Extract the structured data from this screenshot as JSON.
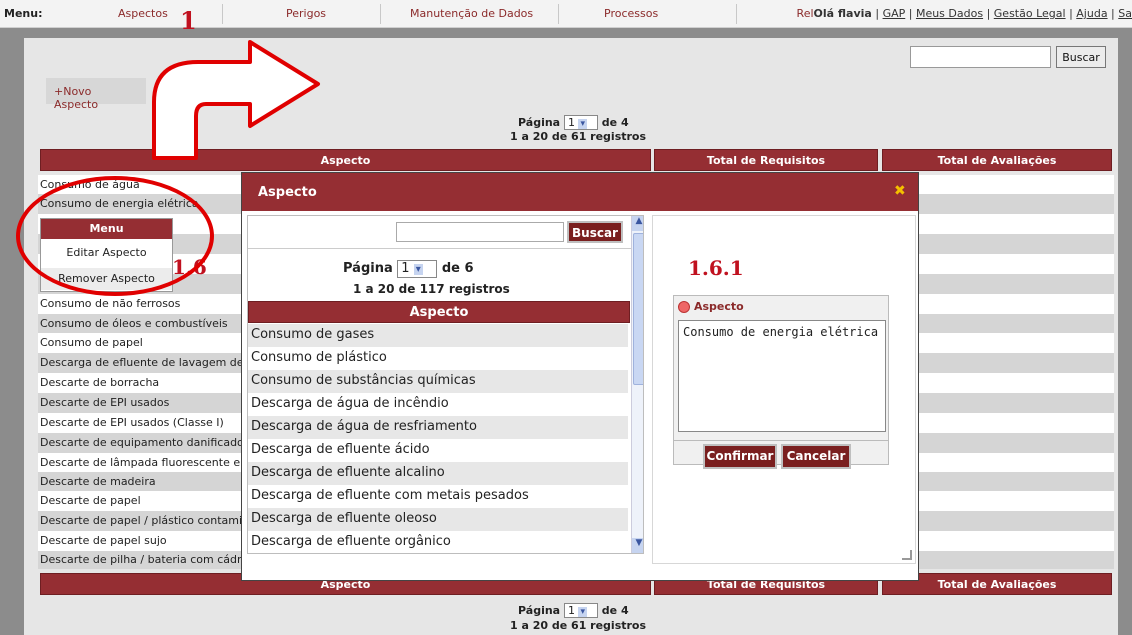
{
  "topbar": {
    "menu_label": "Menu:",
    "items": [
      "Aspectos",
      "Perigos",
      "Manutenção de Dados",
      "Processos"
    ],
    "partial_item": "Rel",
    "user_label": "Olá flavia",
    "links": [
      "GAP",
      "Meus Dados",
      "Gestão Legal",
      "Ajuda",
      "Sa"
    ]
  },
  "search": {
    "button": "Buscar"
  },
  "new_button": "+Novo Aspecto",
  "pagination_top": {
    "label": "Página",
    "value": "1",
    "suffix": "de 4",
    "count": "1 a 20 de 61 registros"
  },
  "table": {
    "headers": [
      "Aspecto",
      "Total de Requisitos",
      "Total de Avaliações"
    ],
    "rows": [
      "Consumo de água",
      "Consumo de energia elétrica",
      "",
      "",
      "",
      "Consumo de não ferrosos",
      "Consumo de óleos e combustíveis",
      "Consumo de papel",
      "Descarga de efluente de lavagem de",
      "Descarte de borracha",
      "Descarte de EPI usados",
      "Descarte de EPI usados (Classe I)",
      "Descarte de equipamento danificado",
      "Descarte de lâmpada fluorescente e",
      "Descarte de madeira",
      "Descarte de papel",
      "Descarte de papel / plástico contamin",
      "Descarte de papel sujo",
      "Descarte de pilha / bateria com cádmio, chumbo e/ou mercúrio"
    ]
  },
  "pagination_bottom": {
    "label": "Página",
    "value": "1",
    "suffix": "de 4",
    "count": "1 a 20 de 61 registros"
  },
  "context_menu": {
    "title": "Menu",
    "items": [
      "Editar Aspecto",
      "Remover Aspecto"
    ]
  },
  "annotations": {
    "a1": "1",
    "a16": "1.6",
    "a161": "1.6.1"
  },
  "modal": {
    "title": "Aspecto",
    "close": "✖",
    "search_button": "Buscar",
    "pagination": {
      "label": "Página",
      "value": "1",
      "suffix": "de 6",
      "count": "1 a 20 de 117 registros"
    },
    "list_header": "Aspecto",
    "list": [
      "Consumo de gases",
      "Consumo de plástico",
      "Consumo de substâncias químicas",
      "Descarga de água de incêndio",
      "Descarga de água de resfriamento",
      "Descarga de efluente ácido",
      "Descarga de efluente alcalino",
      "Descarga de efluente com metais pesados",
      "Descarga de efluente oleoso",
      "Descarga de efluente orgânico"
    ],
    "field_label": "Aspecto",
    "field_value": "Consumo de energia elétrica",
    "confirm": "Confirmar",
    "cancel": "Cancelar"
  },
  "colors": {
    "brand": "#952e33",
    "annotation": "#e00000"
  }
}
